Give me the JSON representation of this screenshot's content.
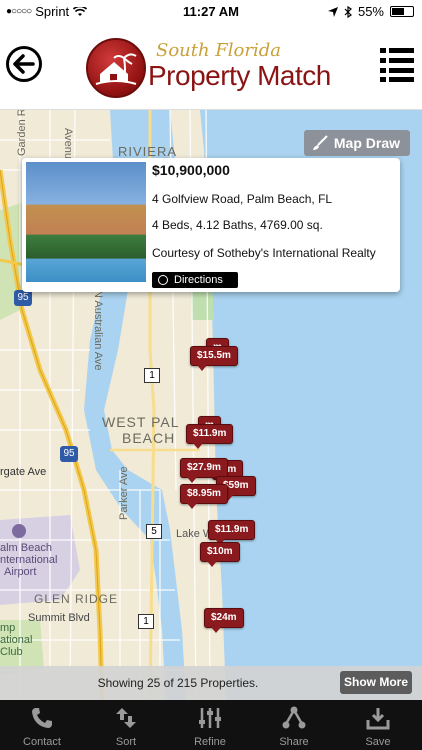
{
  "status_bar": {
    "carrier": "Sprint",
    "signal_dots": "●○○○○",
    "time": "11:27 AM",
    "battery": "55%"
  },
  "header": {
    "logo_top": "South Florida",
    "logo_main": "Property Match"
  },
  "map": {
    "map_draw_label": "Map Draw",
    "labels": {
      "riviera": "RIVIERA",
      "avenue_c": "Avenue C",
      "garden_rd": "Garden Rd",
      "australian_ave": "N Australian Ave",
      "west_palm_beach_1": "WEST PAL",
      "west_palm_beach_2": "BEACH",
      "rgate_ave": "rgate Ave",
      "parker_ave": "Parker Ave",
      "lake_worth": "Lake Worth",
      "glen_ridge": "GLEN RIDGE",
      "summit_blvd": "Summit Blvd",
      "airport_1": "alm Beach",
      "airport_2": "nternational",
      "airport_3": "Airport",
      "club_1": "mp",
      "club_2": "ational",
      "club_3": "Club",
      "route_95_a": "95",
      "route_95_b": "95",
      "route_1_a": "1",
      "route_1_b": "1",
      "route_5": "5"
    },
    "markers": [
      "$15.5m",
      "$11.9m",
      "$27.9m",
      "$8.95m",
      "$59m",
      "$11.9m",
      "$10m",
      "$24m",
      "m",
      "m",
      ".9m"
    ]
  },
  "popup": {
    "price": "$10,900,000",
    "address": "4 Golfview Road, Palm Beach, FL",
    "details": "4 Beds, 4.12 Baths, 4769.00 sq.",
    "courtesy": "Courtesy of Sotheby's International Realty",
    "directions_label": "Directions"
  },
  "results": {
    "showing_text": "Showing 25 of 215 Properties.",
    "show_more_label": "Show More"
  },
  "tabbar": {
    "items": [
      {
        "label": "Contact",
        "icon": "phone-icon"
      },
      {
        "label": "Sort",
        "icon": "sort-arrows-icon"
      },
      {
        "label": "Refine",
        "icon": "sliders-icon"
      },
      {
        "label": "Share",
        "icon": "share-icon"
      },
      {
        "label": "Save",
        "icon": "download-tray-icon"
      }
    ]
  },
  "colors": {
    "brand_red": "#8b1a1e",
    "water": "#a9d3f0",
    "land": "#f0ead7",
    "tab_bg": "#111111"
  }
}
